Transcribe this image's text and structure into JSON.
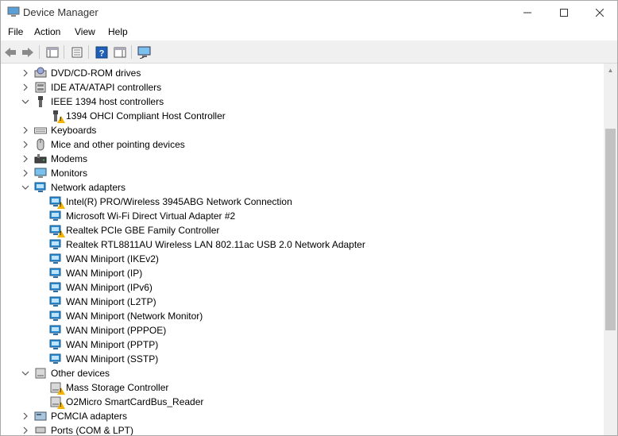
{
  "window": {
    "title": "Device Manager"
  },
  "menu": [
    "File",
    "Action",
    "View",
    "Help"
  ],
  "tree": [
    {
      "label": "DVD/CD-ROM drives",
      "level": 0,
      "expander": "collapsed",
      "icon": "dvd-drive-icon",
      "warning": false
    },
    {
      "label": "IDE ATA/ATAPI controllers",
      "level": 0,
      "expander": "collapsed",
      "icon": "ide-controller-icon",
      "warning": false
    },
    {
      "label": "IEEE 1394 host controllers",
      "level": 0,
      "expander": "expanded",
      "icon": "firewire-icon",
      "warning": false
    },
    {
      "label": "1394 OHCI Compliant Host Controller",
      "level": 1,
      "expander": "none",
      "icon": "firewire-device-icon",
      "warning": true
    },
    {
      "label": "Keyboards",
      "level": 0,
      "expander": "collapsed",
      "icon": "keyboard-icon",
      "warning": false
    },
    {
      "label": "Mice and other pointing devices",
      "level": 0,
      "expander": "collapsed",
      "icon": "mouse-icon",
      "warning": false
    },
    {
      "label": "Modems",
      "level": 0,
      "expander": "collapsed",
      "icon": "modem-icon",
      "warning": false
    },
    {
      "label": "Monitors",
      "level": 0,
      "expander": "collapsed",
      "icon": "monitor-icon",
      "warning": false
    },
    {
      "label": "Network adapters",
      "level": 0,
      "expander": "expanded",
      "icon": "network-adapter-icon",
      "warning": false
    },
    {
      "label": "Intel(R) PRO/Wireless 3945ABG Network Connection",
      "level": 1,
      "expander": "none",
      "icon": "network-adapter-icon",
      "warning": true
    },
    {
      "label": "Microsoft Wi-Fi Direct Virtual Adapter #2",
      "level": 1,
      "expander": "none",
      "icon": "network-adapter-icon",
      "warning": false
    },
    {
      "label": "Realtek PCIe GBE Family Controller",
      "level": 1,
      "expander": "none",
      "icon": "network-adapter-icon",
      "warning": true
    },
    {
      "label": "Realtek RTL8811AU Wireless LAN 802.11ac USB 2.0 Network Adapter",
      "level": 1,
      "expander": "none",
      "icon": "network-adapter-icon",
      "warning": false
    },
    {
      "label": "WAN Miniport (IKEv2)",
      "level": 1,
      "expander": "none",
      "icon": "network-adapter-icon",
      "warning": false
    },
    {
      "label": "WAN Miniport (IP)",
      "level": 1,
      "expander": "none",
      "icon": "network-adapter-icon",
      "warning": false
    },
    {
      "label": "WAN Miniport (IPv6)",
      "level": 1,
      "expander": "none",
      "icon": "network-adapter-icon",
      "warning": false
    },
    {
      "label": "WAN Miniport (L2TP)",
      "level": 1,
      "expander": "none",
      "icon": "network-adapter-icon",
      "warning": false
    },
    {
      "label": "WAN Miniport (Network Monitor)",
      "level": 1,
      "expander": "none",
      "icon": "network-adapter-icon",
      "warning": false
    },
    {
      "label": "WAN Miniport (PPPOE)",
      "level": 1,
      "expander": "none",
      "icon": "network-adapter-icon",
      "warning": false
    },
    {
      "label": "WAN Miniport (PPTP)",
      "level": 1,
      "expander": "none",
      "icon": "network-adapter-icon",
      "warning": false
    },
    {
      "label": "WAN Miniport (SSTP)",
      "level": 1,
      "expander": "none",
      "icon": "network-adapter-icon",
      "warning": false
    },
    {
      "label": "Other devices",
      "level": 0,
      "expander": "expanded",
      "icon": "unknown-device-icon",
      "warning": false
    },
    {
      "label": "Mass Storage Controller",
      "level": 1,
      "expander": "none",
      "icon": "unknown-device-icon",
      "warning": true
    },
    {
      "label": "O2Micro SmartCardBus_Reader",
      "level": 1,
      "expander": "none",
      "icon": "unknown-device-icon",
      "warning": true
    },
    {
      "label": "PCMCIA adapters",
      "level": 0,
      "expander": "collapsed",
      "icon": "pcmcia-icon",
      "warning": false
    },
    {
      "label": "Ports (COM & LPT)",
      "level": 0,
      "expander": "collapsed",
      "icon": "port-icon",
      "warning": false
    }
  ],
  "colors": {
    "warning": "#f5b400",
    "network": "#2b8fd6",
    "toolbar_bg": "#f0f0f0"
  }
}
